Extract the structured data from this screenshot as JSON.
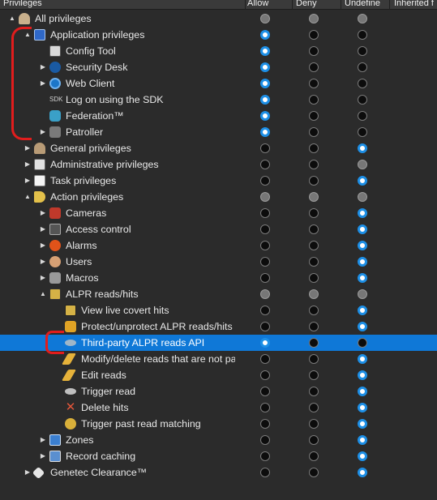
{
  "header": {
    "columns": [
      "Privileges",
      "Allow",
      "Deny",
      "Undefine",
      "Inherited f"
    ]
  },
  "rows": [
    {
      "label": "All privileges",
      "icon": "key-icon",
      "expander": "▲",
      "state": "mixed-mixed-mixed"
    },
    {
      "label": "Application privileges",
      "icon": "application-window-icon",
      "expander": "▲",
      "state": "allow"
    },
    {
      "label": "Config Tool",
      "icon": "config-tool-icon",
      "expander": "",
      "state": "allow"
    },
    {
      "label": "Security Desk",
      "icon": "security-desk-icon",
      "expander": "▶",
      "state": "allow"
    },
    {
      "label": "Web Client",
      "icon": "web-client-icon",
      "expander": "▶",
      "state": "allow"
    },
    {
      "label": "Log on using the SDK",
      "icon": "sdk-icon",
      "sdk_text": "SDK",
      "expander": "",
      "state": "allow"
    },
    {
      "label": "Federation™",
      "icon": "federation-icon",
      "expander": "",
      "state": "allow"
    },
    {
      "label": "Patroller",
      "icon": "patroller-icon",
      "expander": "▶",
      "state": "allow"
    },
    {
      "label": "General privileges",
      "icon": "general-key-icon",
      "expander": "▶",
      "state": "undefined"
    },
    {
      "label": "Administrative privileges",
      "icon": "administrative-icon",
      "expander": "▶",
      "state": "mixed-undef"
    },
    {
      "label": "Task privileges",
      "icon": "task-icon",
      "expander": "▶",
      "state": "undefined"
    },
    {
      "label": "Action privileges",
      "icon": "action-megaphone-icon",
      "expander": "▲",
      "state": "mixed-all"
    },
    {
      "label": "Cameras",
      "icon": "camera-icon",
      "expander": "▶",
      "state": "undefined"
    },
    {
      "label": "Access control",
      "icon": "access-control-icon",
      "expander": "▶",
      "state": "undefined"
    },
    {
      "label": "Alarms",
      "icon": "alarm-icon",
      "expander": "▶",
      "state": "undefined"
    },
    {
      "label": "Users",
      "icon": "users-icon",
      "expander": "▶",
      "state": "undefined"
    },
    {
      "label": "Macros",
      "icon": "macros-icon",
      "expander": "▶",
      "state": "undefined"
    },
    {
      "label": "ALPR reads/hits",
      "icon": "alpr-icon",
      "expander": "▲",
      "state": "mixed-all"
    },
    {
      "label": "View live covert hits",
      "icon": "live-covert-icon",
      "expander": "",
      "state": "undefined"
    },
    {
      "label": "Protect/unprotect ALPR reads/hits",
      "icon": "lock-icon",
      "expander": "",
      "state": "undefined"
    },
    {
      "label": "Third-party ALPR reads API",
      "icon": "cloud-icon",
      "expander": "",
      "state": "allow",
      "selected": true
    },
    {
      "label": "Modify/delete reads that are not pa",
      "icon": "pencil-icon",
      "expander": "",
      "state": "undefined"
    },
    {
      "label": "Edit reads",
      "icon": "edit-pencil-icon",
      "expander": "",
      "state": "undefined"
    },
    {
      "label": "Trigger read",
      "icon": "trigger-icon",
      "expander": "",
      "state": "undefined"
    },
    {
      "label": "Delete hits",
      "icon": "delete-icon",
      "del_glyph": "✕",
      "expander": "",
      "state": "undefined"
    },
    {
      "label": "Trigger past read matching",
      "icon": "past-read-icon",
      "expander": "",
      "state": "undefined"
    },
    {
      "label": "Zones",
      "icon": "zones-icon",
      "expander": "▶",
      "state": "undefined"
    },
    {
      "label": "Record caching",
      "icon": "record-caching-icon",
      "expander": "▶",
      "state": "undefined"
    },
    {
      "label": "Genetec Clearance™",
      "icon": "genetec-clearance-icon",
      "expander": "▶",
      "state": "undefined"
    }
  ],
  "colors": {
    "selected_row": "#0f78d7",
    "radio_on_ring": "#1d8fe6",
    "annotation_red": "#e11d1d"
  }
}
